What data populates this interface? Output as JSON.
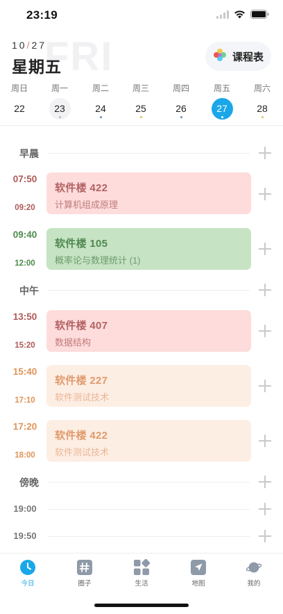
{
  "status_bar": {
    "time": "23:19"
  },
  "header": {
    "month": "10",
    "slash": "/",
    "day": "27",
    "weekday": "星期五",
    "watermark": "FRI",
    "schedule_button_label": "课程表"
  },
  "week": [
    {
      "name": "周日",
      "num": "22",
      "state": "normal",
      "dot": ""
    },
    {
      "name": "周一",
      "num": "23",
      "state": "soft",
      "dot": "#b8b8b8"
    },
    {
      "name": "周二",
      "num": "24",
      "state": "normal",
      "dot": "#5b8fbf"
    },
    {
      "name": "周三",
      "num": "25",
      "state": "normal",
      "dot": "#e0c060"
    },
    {
      "name": "周四",
      "num": "26",
      "state": "normal",
      "dot": "#5b8fbf"
    },
    {
      "name": "周五",
      "num": "27",
      "state": "selected",
      "dot": "#ffffff"
    },
    {
      "name": "周六",
      "num": "28",
      "state": "normal",
      "dot": "#e0c060"
    }
  ],
  "sections": {
    "morning": "早晨",
    "noon": "中午",
    "evening": "傍晚"
  },
  "courses": [
    {
      "start": "07:50",
      "end": "09:20",
      "room": "软件楼 422",
      "name": "计算机组成原理",
      "color": "red"
    },
    {
      "start": "09:40",
      "end": "12:00",
      "room": "软件楼 105",
      "name": "概率论与数理统计 (1)",
      "color": "green"
    },
    {
      "start": "13:50",
      "end": "15:20",
      "room": "软件楼 407",
      "name": "数据结构",
      "color": "red"
    },
    {
      "start": "15:40",
      "end": "17:10",
      "room": "软件楼 227",
      "name": "软件测试技术",
      "color": "peach"
    },
    {
      "start": "17:20",
      "end": "18:00",
      "room": "软件楼 422",
      "name": "软件测试技术",
      "color": "peach"
    }
  ],
  "empty_slots": [
    "19:00",
    "19:50"
  ],
  "tabs": [
    {
      "label": "今日",
      "icon": "clock-icon",
      "active": true
    },
    {
      "label": "圈子",
      "icon": "hashtag-icon",
      "active": false
    },
    {
      "label": "生活",
      "icon": "grid-icon",
      "active": false
    },
    {
      "label": "地图",
      "icon": "location-arrow-icon",
      "active": false
    },
    {
      "label": "我的",
      "icon": "planet-icon",
      "active": false
    }
  ],
  "colors": {
    "accent": "#1aa7ea",
    "card_red": "#fedcdc",
    "card_green": "#c6e3c3",
    "card_peach": "#fdeee4"
  }
}
